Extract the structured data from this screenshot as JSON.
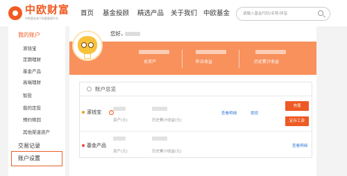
{
  "header": {
    "brand": "中欧财富",
    "brand_sub": "中欧基金旗下财富管理平台",
    "nav": [
      "首页",
      "基金投顾",
      "精选产品",
      "关于我们",
      "中欧基金"
    ],
    "search_placeholder": "请输入基金代码/名称/拼音"
  },
  "sidebar": {
    "my_account": "我的账户",
    "items": [
      "滚钱宝",
      "定期理财",
      "基金产品",
      "高端理财",
      "智投",
      "我的定投",
      "预约赎回",
      "其他渠道资产"
    ],
    "trade_records": "交易记录",
    "account_settings": "账户设置"
  },
  "banner": {
    "greeting": "您好，",
    "stats": [
      "总资产",
      "昨日收益",
      "历史累计收益"
    ]
  },
  "overview": {
    "title": "账户总览",
    "rows": [
      {
        "name": "滚钱宝",
        "help": "?",
        "asset_label": "资产(元)",
        "hist_label": "历史累计收益(元)",
        "detail_link": "查看明细",
        "withdraw_link": "提现",
        "buttons": [
          "充值",
          "定存工资"
        ]
      },
      {
        "name": "基金产品",
        "asset_label": "资产(元)",
        "hist_label": "历史累计收益(元)",
        "detail_link": "查看明细"
      }
    ]
  },
  "colors": {
    "accent": "#f15a22",
    "banner": "#f8915c",
    "link": "#2f7bd4",
    "fund_dot": "#e84b3c",
    "gold_dot": "#f39c12"
  }
}
